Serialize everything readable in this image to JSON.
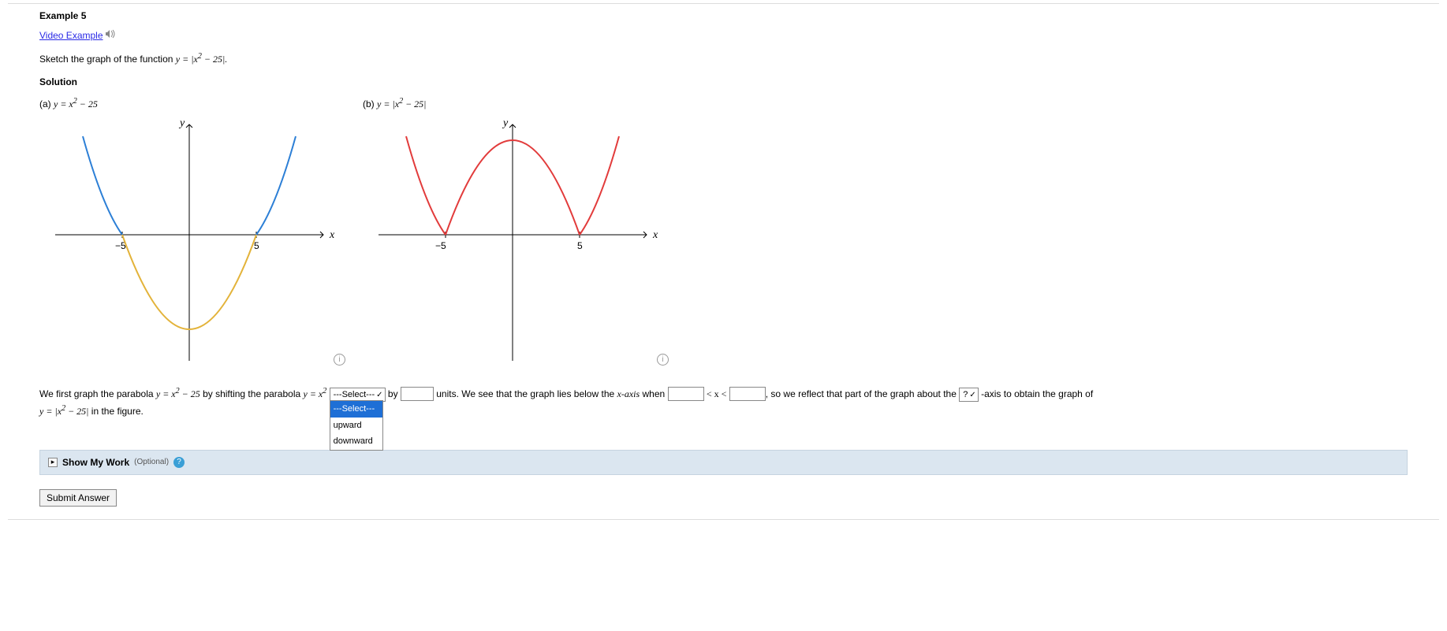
{
  "header": {
    "example_title": "Example 5",
    "video_link": "Video Example",
    "prompt_prefix": "Sketch the graph of the function ",
    "prompt_math": "y = |x² − 25|.",
    "solution_label": "Solution"
  },
  "plots": {
    "a_caption_prefix": "(a)  ",
    "a_caption_math": "y = x² − 25",
    "b_caption_prefix": "(b)  ",
    "b_caption_math": "y = |x² − 25|",
    "axis_y_label": "y",
    "axis_x_label": "x",
    "tick_neg5": "−5",
    "tick_pos5": "5"
  },
  "chart_data": [
    {
      "type": "line",
      "title": "(a) y = x^2 - 25",
      "xlabel": "x",
      "ylabel": "y",
      "xlim": [
        -8,
        8
      ],
      "ylim": [
        -28,
        45
      ],
      "x_ticks": [
        -5,
        5
      ],
      "series": [
        {
          "name": "y = x^2 - 25 (|x|>5)",
          "color": "#2c7fd6",
          "x": [
            -8,
            -7,
            -6,
            -5,
            5,
            6,
            7,
            8
          ],
          "values": [
            39,
            24,
            11,
            0,
            0,
            11,
            24,
            39
          ]
        },
        {
          "name": "y = x^2 - 25 (|x|<=5)",
          "color": "#e3b33a",
          "x": [
            -5,
            -4,
            -3,
            -2,
            -1,
            0,
            1,
            2,
            3,
            4,
            5
          ],
          "values": [
            0,
            -9,
            -16,
            -21,
            -24,
            -25,
            -24,
            -21,
            -16,
            -9,
            0
          ]
        }
      ]
    },
    {
      "type": "line",
      "title": "(b) y = |x^2 - 25|",
      "xlabel": "x",
      "ylabel": "y",
      "xlim": [
        -8,
        8
      ],
      "ylim": [
        -5,
        45
      ],
      "x_ticks": [
        -5,
        5
      ],
      "series": [
        {
          "name": "y = |x^2 - 25|",
          "color": "#e23b3b",
          "x": [
            -8,
            -7,
            -6,
            -5,
            -4,
            -3,
            -2,
            -1,
            0,
            1,
            2,
            3,
            4,
            5,
            6,
            7,
            8
          ],
          "values": [
            39,
            24,
            11,
            0,
            9,
            16,
            21,
            24,
            25,
            24,
            21,
            16,
            9,
            0,
            11,
            24,
            39
          ]
        }
      ]
    }
  ],
  "sentence": {
    "s1_a": "We first graph the parabola ",
    "s1_math1": "y = x² − 25",
    "s1_b": " by shifting the parabola ",
    "s1_math2": "y = x²",
    "direction_display": "---Select---",
    "direction_options": [
      "---Select---",
      "upward",
      "downward"
    ],
    "by_word": " by ",
    "units_word": " units. We see that the graph lies below the ",
    "xaxis_word": "x-axis",
    "when_word": " when ",
    "lt_x_lt": "< x <",
    "reflect_a": ", so we reflect that part of the graph about the ",
    "axis_sel_display": "?",
    "s2_tail_a": "-axis to obtain the graph of",
    "s2_line2_math": "y = |x² − 25|",
    "s2_line2_tail": " in the figure."
  },
  "footer": {
    "show_my_work": "Show My Work",
    "optional": "(Optional)",
    "submit": "Submit Answer"
  }
}
